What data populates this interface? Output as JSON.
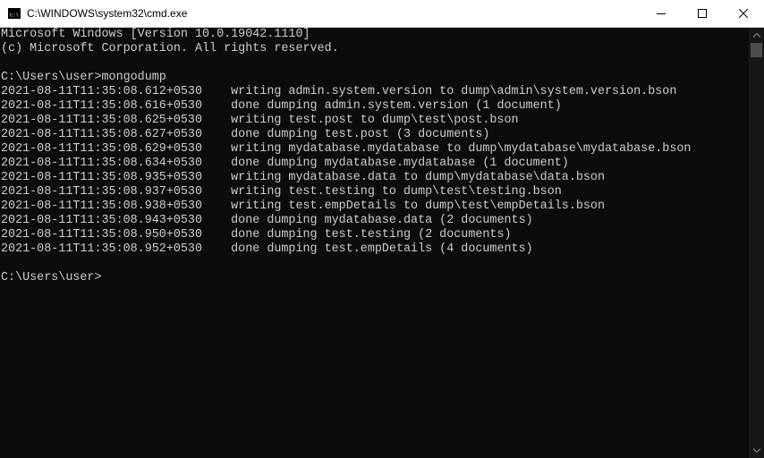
{
  "window": {
    "title": "C:\\WINDOWS\\system32\\cmd.exe"
  },
  "console": {
    "lines": [
      "Microsoft Windows [Version 10.0.19042.1110]",
      "(c) Microsoft Corporation. All rights reserved.",
      "",
      "C:\\Users\\user>mongodump",
      "2021-08-11T11:35:08.612+0530    writing admin.system.version to dump\\admin\\system.version.bson",
      "2021-08-11T11:35:08.616+0530    done dumping admin.system.version (1 document)",
      "2021-08-11T11:35:08.625+0530    writing test.post to dump\\test\\post.bson",
      "2021-08-11T11:35:08.627+0530    done dumping test.post (3 documents)",
      "2021-08-11T11:35:08.629+0530    writing mydatabase.mydatabase to dump\\mydatabase\\mydatabase.bson",
      "2021-08-11T11:35:08.634+0530    done dumping mydatabase.mydatabase (1 document)",
      "2021-08-11T11:35:08.935+0530    writing mydatabase.data to dump\\mydatabase\\data.bson",
      "2021-08-11T11:35:08.937+0530    writing test.testing to dump\\test\\testing.bson",
      "2021-08-11T11:35:08.938+0530    writing test.empDetails to dump\\test\\empDetails.bson",
      "2021-08-11T11:35:08.943+0530    done dumping mydatabase.data (2 documents)",
      "2021-08-11T11:35:08.950+0530    done dumping test.testing (2 documents)",
      "2021-08-11T11:35:08.952+0530    done dumping test.empDetails (4 documents)",
      "",
      "C:\\Users\\user>"
    ]
  },
  "colors": {
    "background": "#0c0c0c",
    "text": "#cccccc",
    "titlebar": "#ffffff"
  },
  "icons": {
    "app": "cmd-icon",
    "minimize": "minimize-icon",
    "maximize": "maximize-icon",
    "close": "close-icon"
  }
}
